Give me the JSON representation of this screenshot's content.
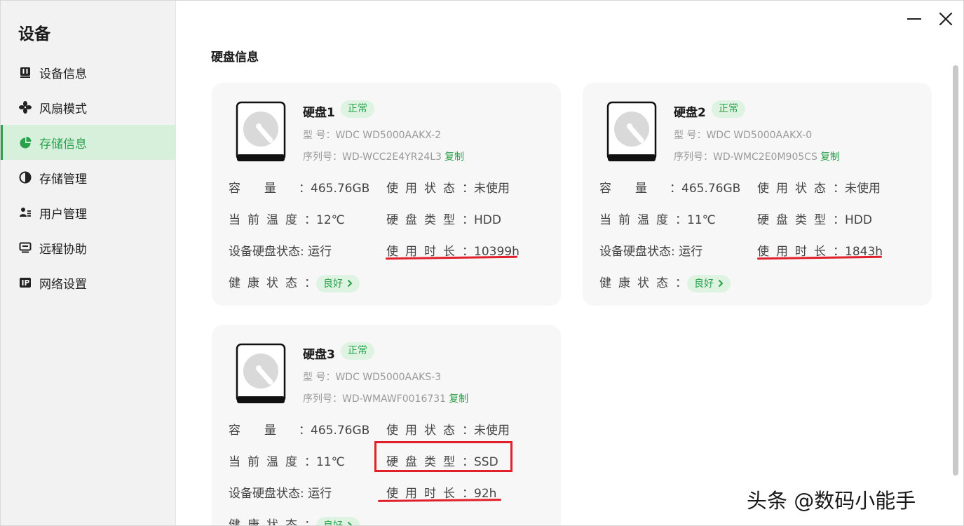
{
  "sidebar": {
    "title": "设备",
    "items": [
      {
        "label": "设备信息",
        "icon": "device-info-icon"
      },
      {
        "label": "风扇模式",
        "icon": "fan-icon"
      },
      {
        "label": "存储信息",
        "icon": "storage-pie-icon",
        "active": true
      },
      {
        "label": "存储管理",
        "icon": "storage-manage-icon"
      },
      {
        "label": "用户管理",
        "icon": "users-icon"
      },
      {
        "label": "远程协助",
        "icon": "remote-monitor-icon"
      },
      {
        "label": "网络设置",
        "icon": "ip-icon"
      }
    ]
  },
  "window": {
    "minimize_icon": "minimize-icon",
    "close_icon": "close-icon"
  },
  "main": {
    "section_title": "硬盘信息"
  },
  "labels": {
    "model": "型 号：",
    "serial": "序列号：",
    "copy": "复制",
    "capacity": "容　　量",
    "temp": "当前温度",
    "disk_status": "设备硬盘状态:",
    "use_status": "使用状态",
    "disk_type": "硬盘类型",
    "use_time": "使用时长",
    "health": "健康状态",
    "colon": "："
  },
  "disks": [
    {
      "name": "硬盘1",
      "badge": "正常",
      "model": "WDC WD5000AAKX-2",
      "serial": "WD-WCC2E4YR24L3",
      "capacity": "465.76GB",
      "temp": "12℃",
      "disk_status": "运行",
      "use_status": "未使用",
      "disk_type": "HDD",
      "use_time": "10399h",
      "health": "良好"
    },
    {
      "name": "硬盘2",
      "badge": "正常",
      "model": "WDC WD5000AAKX-0",
      "serial": "WD-WMC2E0M905CS",
      "capacity": "465.76GB",
      "temp": "11℃",
      "disk_status": "运行",
      "use_status": "未使用",
      "disk_type": "HDD",
      "use_time": "1843h",
      "health": "良好"
    },
    {
      "name": "硬盘3",
      "badge": "正常",
      "model": "WDC WD5000AAKS-3",
      "serial": "WD-WMAWF0016731",
      "capacity": "465.76GB",
      "temp": "11℃",
      "disk_status": "运行",
      "use_status": "未使用",
      "disk_type": "SSD",
      "use_time": "92h",
      "health": "良好"
    }
  ],
  "watermark": "头条 @数码小能手",
  "colors": {
    "accent": "#2aa14a",
    "accent_bg": "#dff3e3",
    "annotation_red": "#e0202a"
  }
}
